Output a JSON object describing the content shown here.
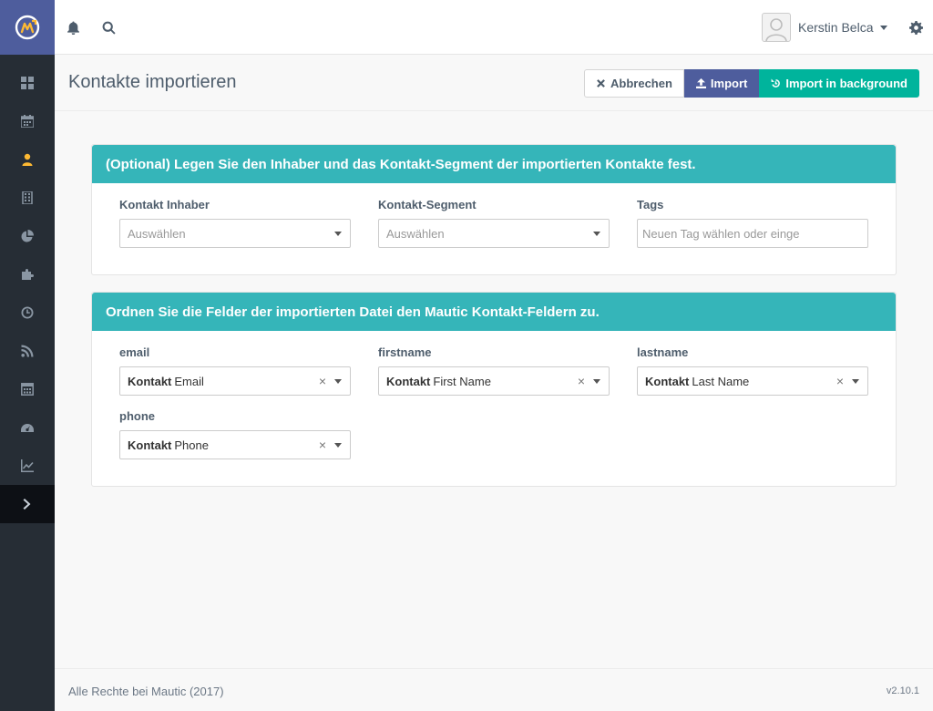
{
  "app": {
    "logo_icon": "mautic-logo-icon",
    "brand_color": "#4e5d9d",
    "accent_color": "#fdb933"
  },
  "sidebar": {
    "items": [
      {
        "name": "dashboard",
        "icon": "dashboard-icon",
        "active": false
      },
      {
        "name": "calendar",
        "icon": "calendar-icon",
        "active": false
      },
      {
        "name": "contacts",
        "icon": "user-icon",
        "active": true
      },
      {
        "name": "companies",
        "icon": "building-icon",
        "active": false
      },
      {
        "name": "reports",
        "icon": "pie-chart-icon",
        "active": false
      },
      {
        "name": "components",
        "icon": "puzzle-icon",
        "active": false
      },
      {
        "name": "history",
        "icon": "clock-icon",
        "active": false
      },
      {
        "name": "channels",
        "icon": "rss-icon",
        "active": false
      },
      {
        "name": "calculator",
        "icon": "calculator-icon",
        "active": false
      },
      {
        "name": "points",
        "icon": "gauge-icon",
        "active": false
      },
      {
        "name": "stats",
        "icon": "line-chart-icon",
        "active": false
      }
    ],
    "toggle_icon": "chevron-right-icon"
  },
  "topbar": {
    "notifications_icon": "bell-icon",
    "search_icon": "search-icon",
    "user_name": "Kerstin Belca",
    "settings_icon": "gear-icon"
  },
  "page": {
    "title": "Kontakte importieren",
    "buttons": {
      "cancel": "Abbrechen",
      "import": "Import",
      "import_background": "Import in background"
    }
  },
  "owner_panel": {
    "heading": "(Optional) Legen Sie den Inhaber und das Kontakt-Segment der importierten Kontakte fest.",
    "owner": {
      "label": "Kontakt Inhaber",
      "placeholder": "Auswählen"
    },
    "segment": {
      "label": "Kontakt-Segment",
      "placeholder": "Auswählen"
    },
    "tags": {
      "label": "Tags",
      "placeholder": "Neuen Tag wählen oder einge"
    }
  },
  "mapping_panel": {
    "heading": "Ordnen Sie die Felder der importierten Datei den Mautic Kontakt-Feldern zu.",
    "fields": [
      {
        "label": "email",
        "group": "Kontakt",
        "value": "Email"
      },
      {
        "label": "firstname",
        "group": "Kontakt",
        "value": "First Name"
      },
      {
        "label": "lastname",
        "group": "Kontakt",
        "value": "Last Name"
      },
      {
        "label": "phone",
        "group": "Kontakt",
        "value": "Phone"
      }
    ],
    "clear_symbol": "×"
  },
  "footer": {
    "copyright": "Alle Rechte bei Mautic (2017)",
    "version": "v2.10.1"
  }
}
